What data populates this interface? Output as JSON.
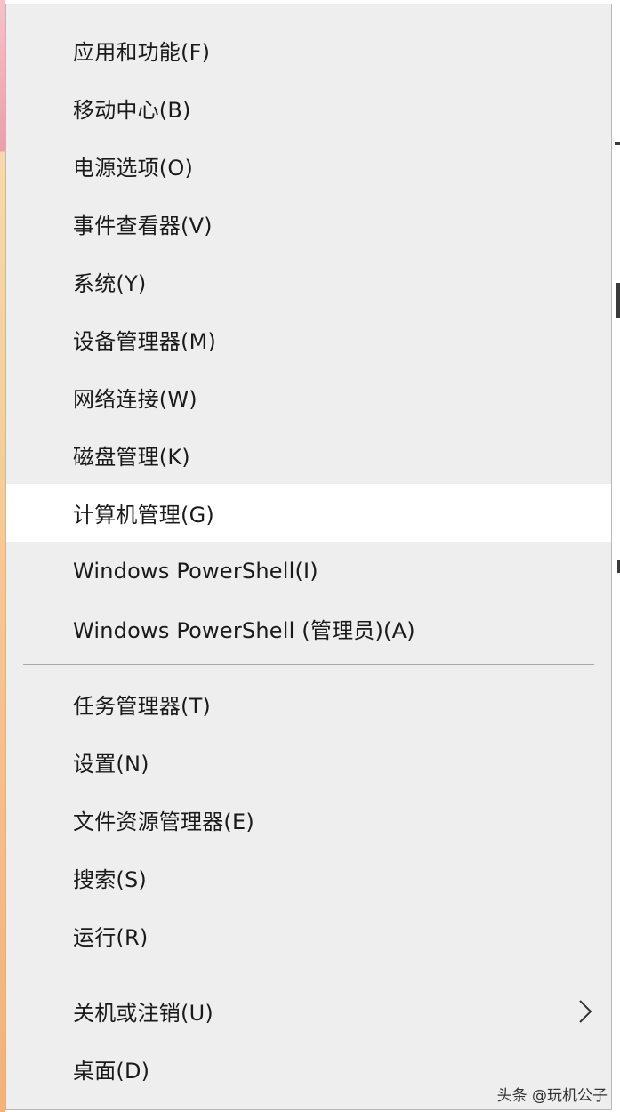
{
  "menu": {
    "group1": [
      {
        "label": "应用和功能(F)",
        "name": "menu-item-apps-features"
      },
      {
        "label": "移动中心(B)",
        "name": "menu-item-mobility-center"
      },
      {
        "label": "电源选项(O)",
        "name": "menu-item-power-options"
      },
      {
        "label": "事件查看器(V)",
        "name": "menu-item-event-viewer"
      },
      {
        "label": "系统(Y)",
        "name": "menu-item-system"
      },
      {
        "label": "设备管理器(M)",
        "name": "menu-item-device-manager"
      },
      {
        "label": "网络连接(W)",
        "name": "menu-item-network-connections"
      },
      {
        "label": "磁盘管理(K)",
        "name": "menu-item-disk-management"
      },
      {
        "label": "计算机管理(G)",
        "name": "menu-item-computer-management"
      },
      {
        "label": "Windows PowerShell(I)",
        "name": "menu-item-powershell"
      },
      {
        "label": "Windows PowerShell (管理员)(A)",
        "name": "menu-item-powershell-admin"
      }
    ],
    "group2": [
      {
        "label": "任务管理器(T)",
        "name": "menu-item-task-manager"
      },
      {
        "label": "设置(N)",
        "name": "menu-item-settings"
      },
      {
        "label": "文件资源管理器(E)",
        "name": "menu-item-file-explorer"
      },
      {
        "label": "搜索(S)",
        "name": "menu-item-search"
      },
      {
        "label": "运行(R)",
        "name": "menu-item-run"
      }
    ],
    "group3": [
      {
        "label": "关机或注销(U)",
        "name": "menu-item-shutdown-signout"
      },
      {
        "label": "桌面(D)",
        "name": "menu-item-desktop"
      }
    ],
    "highlighted": "计算机管理(G)",
    "submenu_icon": "chevron-right-icon"
  },
  "watermark": {
    "text": "头条 @玩机公子"
  },
  "colors": {
    "menu_background": "#eeeeee",
    "highlight_background": "#ffffff",
    "text": "#1a1a1a",
    "separator": "#a9a9a9"
  }
}
